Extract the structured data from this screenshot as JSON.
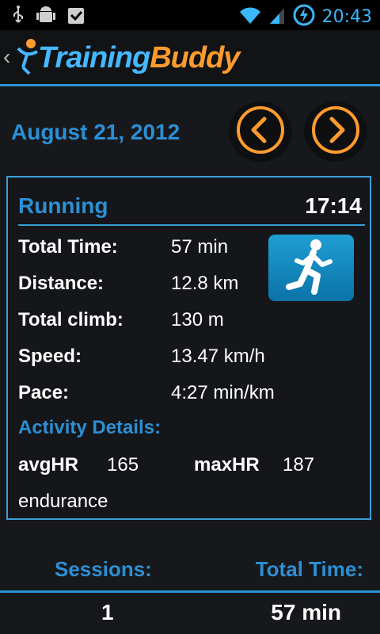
{
  "status_bar": {
    "time": "20:43",
    "left_icons": [
      "usb-icon",
      "android-debug-icon",
      "clipboard-check-icon"
    ],
    "right_icons": [
      "wifi-icon",
      "signal-icon",
      "battery-charging-icon"
    ]
  },
  "app_bar": {
    "logo_part1": "Training",
    "logo_part2": "Buddy",
    "back_glyph": "‹"
  },
  "date_nav": {
    "date": "August 21, 2012",
    "prev_icon": "chevron-left-icon",
    "next_icon": "chevron-right-icon"
  },
  "activity": {
    "type": "Running",
    "start_time": "17:14",
    "icon": "runner-icon",
    "stats": [
      {
        "label": "Total Time:",
        "value": "57 min"
      },
      {
        "label": "Distance:",
        "value": "12.8 km"
      },
      {
        "label": "Total climb:",
        "value": "130 m"
      },
      {
        "label": "Speed:",
        "value": "13.47 km/h"
      },
      {
        "label": "Pace:",
        "value": "4:27 min/km"
      }
    ],
    "details_title": "Activity Details:",
    "avg_hr_label": "avgHR",
    "avg_hr_value": "165",
    "max_hr_label": "maxHR",
    "max_hr_value": "187",
    "note": "endurance"
  },
  "summary": {
    "sessions_label": "Sessions:",
    "sessions_value": "1",
    "total_time_label": "Total Time:",
    "total_time_value": "57 min"
  },
  "colors": {
    "accent_blue": "#2c8fd4",
    "accent_orange": "#ff9b2e",
    "background": "#16181b"
  }
}
